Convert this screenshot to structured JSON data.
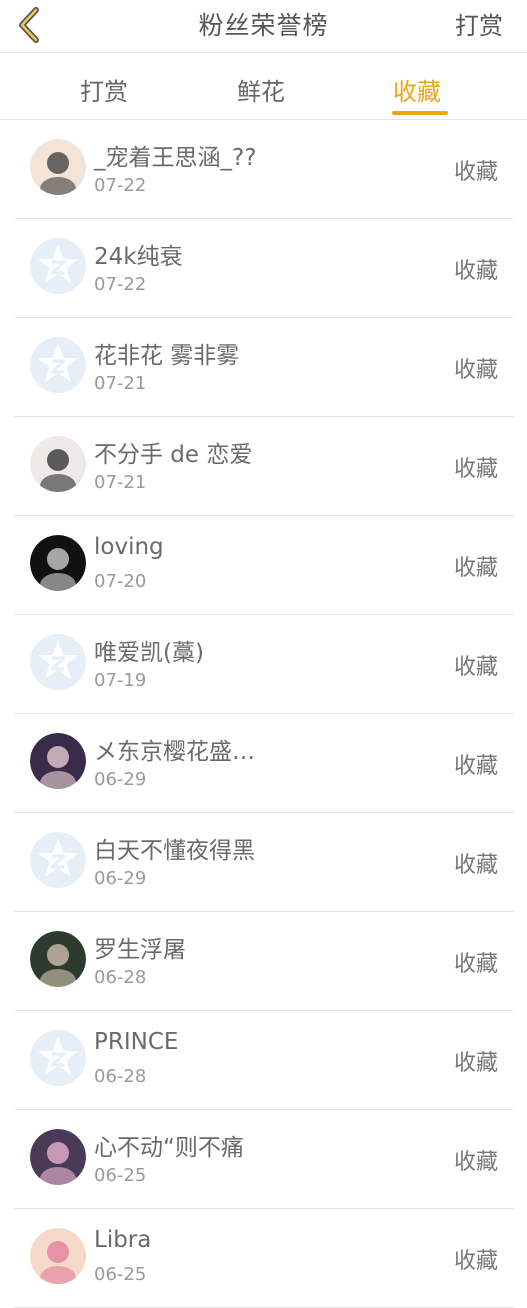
{
  "header": {
    "back_icon": "chevron-left-icon",
    "title": "粉丝荣誉榜",
    "right_action": "打赏"
  },
  "tabs": [
    {
      "label": "打赏",
      "active": false
    },
    {
      "label": "鲜花",
      "active": false
    },
    {
      "label": "收藏",
      "active": true
    }
  ],
  "colors": {
    "accent": "#f0a417",
    "default_avatar": "#e6eef7"
  },
  "list": [
    {
      "name": "_宠着王思涵_??",
      "date": "07-22",
      "action": "收藏",
      "avatar": "photo-avatar"
    },
    {
      "name": "24k纯衰",
      "date": "07-22",
      "action": "收藏",
      "avatar": "default-avatar-icon"
    },
    {
      "name": "花非花 雾非雾",
      "date": "07-21",
      "action": "收藏",
      "avatar": "default-avatar-icon"
    },
    {
      "name": "不分手 de 恋爱",
      "date": "07-21",
      "action": "收藏",
      "avatar": "photo-avatar"
    },
    {
      "name": "loving",
      "date": "07-20",
      "action": "收藏",
      "avatar": "photo-avatar"
    },
    {
      "name": "唯爱凯(藁)",
      "date": "07-19",
      "action": "收藏",
      "avatar": "default-avatar-icon"
    },
    {
      "name": "メ东京樱花盛…",
      "date": "06-29",
      "action": "收藏",
      "avatar": "photo-avatar"
    },
    {
      "name": "白天不懂夜得黑",
      "date": "06-29",
      "action": "收藏",
      "avatar": "default-avatar-icon"
    },
    {
      "name": "罗生浮屠",
      "date": "06-28",
      "action": "收藏",
      "avatar": "photo-avatar"
    },
    {
      "name": "PRINCE",
      "date": "06-28",
      "action": "收藏",
      "avatar": "default-avatar-icon"
    },
    {
      "name": "心不动“则不痛",
      "date": "06-25",
      "action": "收藏",
      "avatar": "photo-avatar"
    },
    {
      "name": "Libra",
      "date": "06-25",
      "action": "收藏",
      "avatar": "photo-avatar"
    }
  ]
}
